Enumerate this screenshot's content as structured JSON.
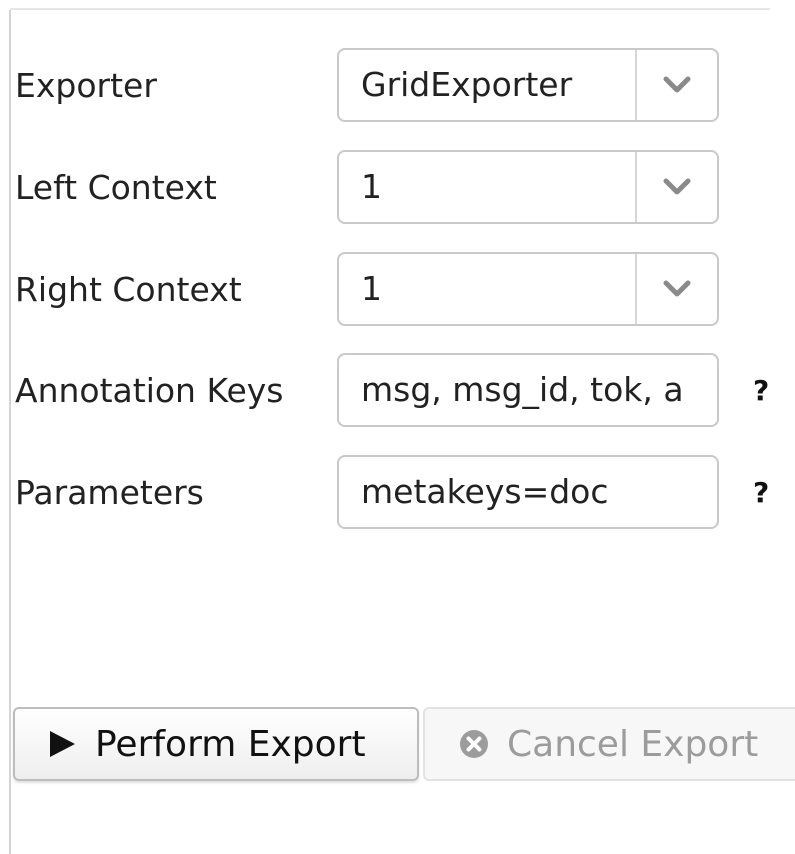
{
  "form": {
    "exporter": {
      "label": "Exporter",
      "value": "GridExporter",
      "toggle_icon": "chevron-down-icon"
    },
    "left_context": {
      "label": "Left Context",
      "value": "1",
      "toggle_icon": "chevron-down-icon"
    },
    "right_context": {
      "label": "Right Context",
      "value": "1",
      "toggle_icon": "chevron-down-icon"
    },
    "annotation_keys": {
      "label": "Annotation Keys",
      "value": "msg, msg_id, tok, a",
      "help": "?"
    },
    "parameters": {
      "label": "Parameters",
      "value": "metakeys=doc",
      "help": "?"
    }
  },
  "actions": {
    "perform": {
      "label": "Perform Export",
      "icon": "play-icon"
    },
    "cancel": {
      "label": "Cancel Export",
      "icon": "cancel-circle-icon"
    }
  },
  "colors": {
    "field_border": "#c9c9c9",
    "text": "#222222",
    "disabled_text": "#9c9c9c",
    "chevron": "#8a8a8a"
  }
}
